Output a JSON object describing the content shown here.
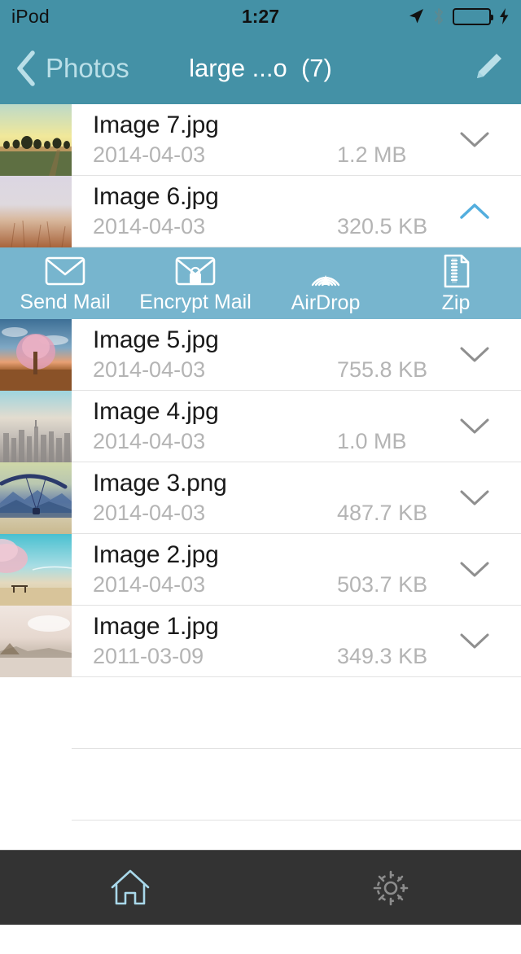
{
  "status_bar": {
    "carrier": "iPod",
    "time": "1:27",
    "location_icon": "location-arrow-icon",
    "bluetooth_icon": "bluetooth-icon",
    "battery_icon": "battery-full-icon",
    "charging_icon": "lightning-bolt-icon",
    "battery_level": "100",
    "battery_color": "#4cd34c"
  },
  "nav_bar": {
    "back_label": "Photos",
    "back_icon": "chevron-left-icon",
    "title": "large ...o  (7)",
    "edit_icon": "pencil-icon",
    "background_color": "#4491a6"
  },
  "files": [
    {
      "name": "Image 7.jpg",
      "date": "2014-04-03",
      "size": "1.2 MB",
      "chevron": "chevron-down-icon",
      "expanded": false
    },
    {
      "name": "Image 6.jpg",
      "date": "2014-04-03",
      "size": "320.5 KB",
      "chevron": "chevron-up-icon",
      "expanded": true
    },
    {
      "name": "Image 5.jpg",
      "date": "2014-04-03",
      "size": "755.8 KB",
      "chevron": "chevron-down-icon",
      "expanded": false
    },
    {
      "name": "Image 4.jpg",
      "date": "2014-04-03",
      "size": "1.0 MB",
      "chevron": "chevron-down-icon",
      "expanded": false
    },
    {
      "name": "Image 3.png",
      "date": "2014-04-03",
      "size": "487.7 KB",
      "chevron": "chevron-down-icon",
      "expanded": false
    },
    {
      "name": "Image 2.jpg",
      "date": "2014-04-03",
      "size": "503.7 KB",
      "chevron": "chevron-down-icon",
      "expanded": false
    },
    {
      "name": "Image 1.jpg",
      "date": "2011-03-09",
      "size": "349.3 KB",
      "chevron": "chevron-down-icon",
      "expanded": false
    }
  ],
  "action_bar": {
    "background_color": "#77b5ce",
    "actions": [
      {
        "label": "Send Mail",
        "icon": "envelope-icon"
      },
      {
        "label": "Encrypt Mail",
        "icon": "envelope-lock-icon"
      },
      {
        "label": "AirDrop",
        "icon": "airdrop-icon"
      },
      {
        "label": "Zip",
        "icon": "zip-file-icon"
      }
    ]
  },
  "tab_bar": {
    "background_color": "#333333",
    "active_color": "#a9d8ea",
    "inactive_color": "#8c8c8c",
    "tabs": [
      {
        "icon": "home-icon",
        "active": true
      },
      {
        "icon": "gear-icon",
        "active": false
      }
    ]
  }
}
